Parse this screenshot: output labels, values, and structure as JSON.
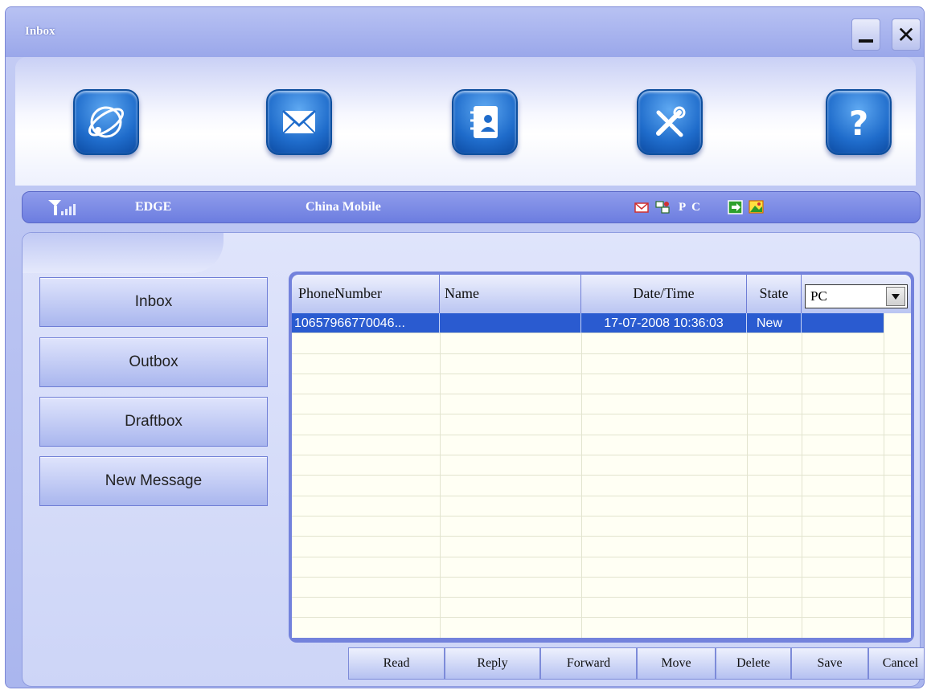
{
  "window": {
    "title": "Inbox"
  },
  "toolbar": {
    "items": [
      {
        "icon": "internet-icon"
      },
      {
        "icon": "sms-envelope-icon"
      },
      {
        "icon": "phonebook-icon"
      },
      {
        "icon": "settings-tools-icon"
      },
      {
        "icon": "help-icon"
      }
    ]
  },
  "status": {
    "network_type": "EDGE",
    "operator": "China Mobile",
    "storage_label": "P C"
  },
  "sidebar": {
    "items": [
      {
        "label": "Inbox"
      },
      {
        "label": "Outbox"
      },
      {
        "label": "Draftbox"
      },
      {
        "label": "New Message"
      }
    ]
  },
  "table": {
    "headers": [
      "PhoneNumber",
      "Name",
      "Date/Time",
      "State"
    ],
    "filter": {
      "selected": "PC"
    },
    "rows": [
      {
        "phone": "10657966770046...",
        "name": "",
        "datetime": "17-07-2008 10:36:03",
        "state": "New"
      }
    ]
  },
  "actions": [
    "Read",
    "Reply",
    "Forward",
    "Move",
    "Delete",
    "Save",
    "Cancel"
  ],
  "colors": {
    "selection": "#2a5bd0",
    "accent": "#1f6ccb"
  }
}
